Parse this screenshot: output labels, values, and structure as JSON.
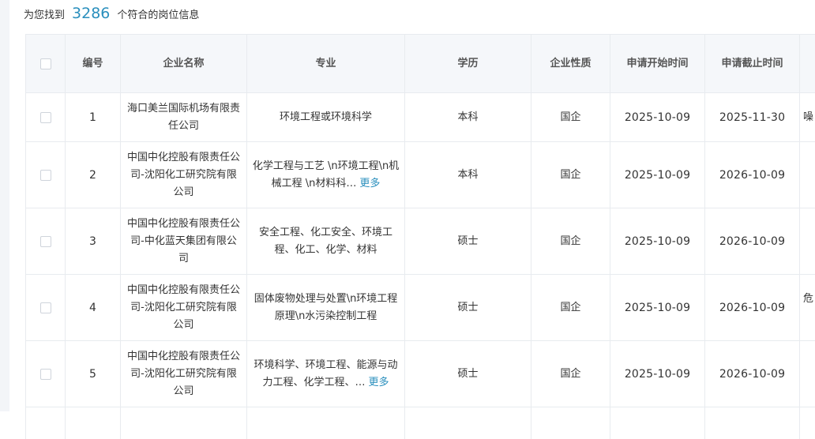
{
  "summary": {
    "prefix": "为您找到",
    "count": "3286",
    "suffix": "个符合的岗位信息"
  },
  "table": {
    "headers": {
      "no": "编号",
      "company": "企业名称",
      "major": "专业",
      "education": "学历",
      "company_type": "企业性质",
      "apply_start": "申请开始时间",
      "apply_end": "申请截止时间"
    },
    "more_label": "更多",
    "rows": [
      {
        "no": "1",
        "company": "海口美兰国际机场有限责任公司",
        "major": "环境工程或环境科学",
        "education": "本科",
        "company_type": "国企",
        "apply_start": "2025-10-09",
        "apply_end": "2025-11-30",
        "extra": "噪"
      },
      {
        "no": "2",
        "company": "中国中化控股有限责任公司-沈阳化工研究院有限公司",
        "major": "化学工程与工艺 \\n环境工程\\n机械工程 \\n材料科…",
        "education": "本科",
        "company_type": "国企",
        "apply_start": "2025-10-09",
        "apply_end": "2026-10-09",
        "extra": ""
      },
      {
        "no": "3",
        "company": "中国中化控股有限责任公司-中化蓝天集团有限公司",
        "major": "安全工程、化工安全、环境工程、化工、化学、材料",
        "education": "硕士",
        "company_type": "国企",
        "apply_start": "2025-10-09",
        "apply_end": "2026-10-09",
        "extra": ""
      },
      {
        "no": "4",
        "company": "中国中化控股有限责任公司-沈阳化工研究院有限公司",
        "major": "固体废物处理与处置\\n环境工程原理\\n水污染控制工程",
        "education": "硕士",
        "company_type": "国企",
        "apply_start": "2025-10-09",
        "apply_end": "2026-10-09",
        "extra": "危"
      },
      {
        "no": "5",
        "company": "中国中化控股有限责任公司-沈阳化工研究院有限公司",
        "major": "环境科学、环境工程、能源与动力工程、化学工程、…",
        "education": "硕士",
        "company_type": "国企",
        "apply_start": "2025-10-09",
        "apply_end": "2026-10-09",
        "extra": ""
      }
    ]
  }
}
